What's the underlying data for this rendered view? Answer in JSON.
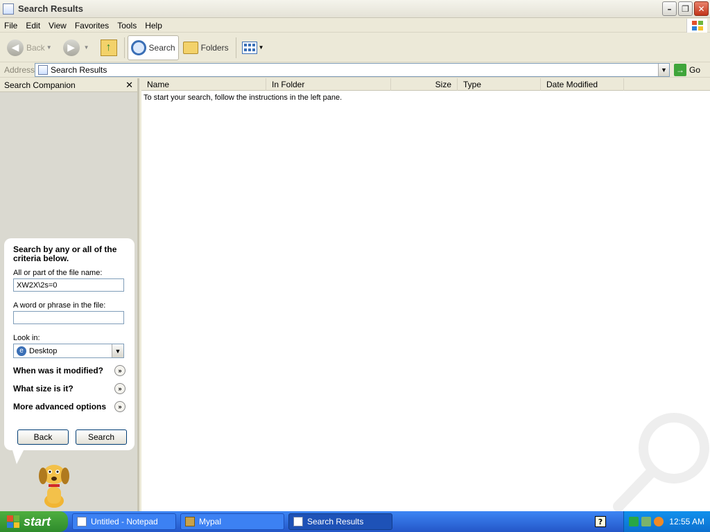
{
  "window": {
    "title": "Search Results"
  },
  "menu": {
    "items": [
      "File",
      "Edit",
      "View",
      "Favorites",
      "Tools",
      "Help"
    ]
  },
  "toolbar": {
    "back_label": "Back",
    "search_label": "Search",
    "folders_label": "Folders"
  },
  "address": {
    "label": "Address",
    "value": "Search Results",
    "go_label": "Go"
  },
  "search_companion": {
    "header": "Search Companion",
    "heading": "Search by any or all of the criteria below.",
    "filename_label": "All or part of the file name:",
    "filename_value": "XW2X\\2s=0",
    "phrase_label": "A word or phrase in the file:",
    "phrase_value": "",
    "look_in_label": "Look in:",
    "look_in_value": "Desktop",
    "expanders": [
      "When was it modified?",
      "What size is it?",
      "More advanced options"
    ],
    "back_button": "Back",
    "search_button": "Search"
  },
  "results": {
    "columns": [
      "Name",
      "In Folder",
      "Size",
      "Type",
      "Date Modified"
    ],
    "instructions": "To start your search, follow the instructions in the left pane."
  },
  "taskbar": {
    "start_label": "start",
    "tasks": [
      "Untitled - Notepad",
      "Mypal",
      "Search Results"
    ],
    "active_task": "Search Results",
    "clock": "12:55 AM"
  }
}
